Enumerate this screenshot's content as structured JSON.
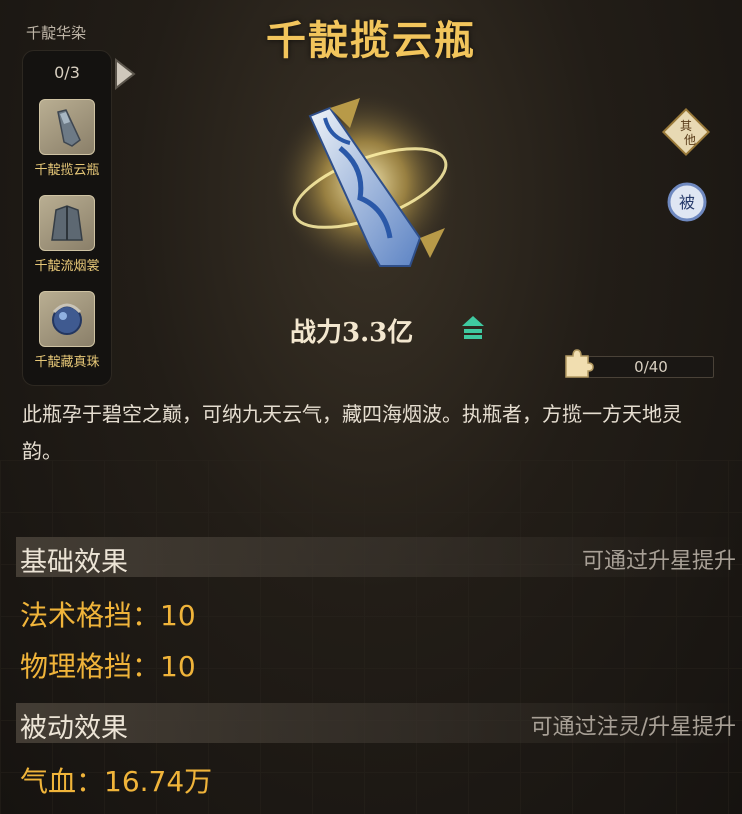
{
  "title": "千靛揽云瓶",
  "set": {
    "name": "千靛华染",
    "progress": "0/3",
    "items": [
      {
        "label": "千靛揽云瓶",
        "icon": "bottle-icon"
      },
      {
        "label": "千靛流烟裳",
        "icon": "robe-icon"
      },
      {
        "label": "千靛藏真珠",
        "icon": "pearl-icon"
      }
    ]
  },
  "badges": {
    "other": "其他",
    "passive": "被"
  },
  "power": "战力3.3亿",
  "shards": {
    "progress": "0/40"
  },
  "description": "此瓶孕于碧空之巅，可纳九天云气，藏四海烟波。执瓶者，方揽一方天地灵韵。",
  "basic_effect": {
    "title": "基础效果",
    "hint": "可通过升星提升",
    "stats": [
      "法术格挡：10",
      "物理格挡：10"
    ]
  },
  "passive_effect": {
    "title": "被动效果",
    "hint": "可通过注灵/升星提升",
    "stats": [
      "气血：16.74万"
    ]
  },
  "colors": {
    "title": "#f2c55c",
    "stat": "#f0b43a",
    "power_up": "#3fc9a0"
  }
}
